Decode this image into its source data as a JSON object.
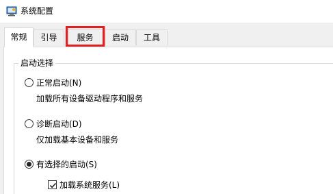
{
  "window": {
    "title": "系统配置",
    "icon": "system-config-icon"
  },
  "tabs": [
    {
      "label": "常规",
      "active": true
    },
    {
      "label": "引导",
      "active": false
    },
    {
      "label": "服务",
      "active": false,
      "highlighted": true
    },
    {
      "label": "启动",
      "active": false
    },
    {
      "label": "工具",
      "active": false
    }
  ],
  "highlight_color": "#e02020",
  "startup_group": {
    "label": "启动选择",
    "options": [
      {
        "label": "正常启动(N)",
        "description": "加载所有设备驱动程序和服务",
        "selected": false
      },
      {
        "label": "诊断启动(D)",
        "description": "仅加载基本设备和服务",
        "selected": false
      },
      {
        "label": "有选择的启动(S)",
        "selected": true
      }
    ],
    "checkbox": {
      "label": "加载系统服务(L)",
      "checked": true
    }
  }
}
